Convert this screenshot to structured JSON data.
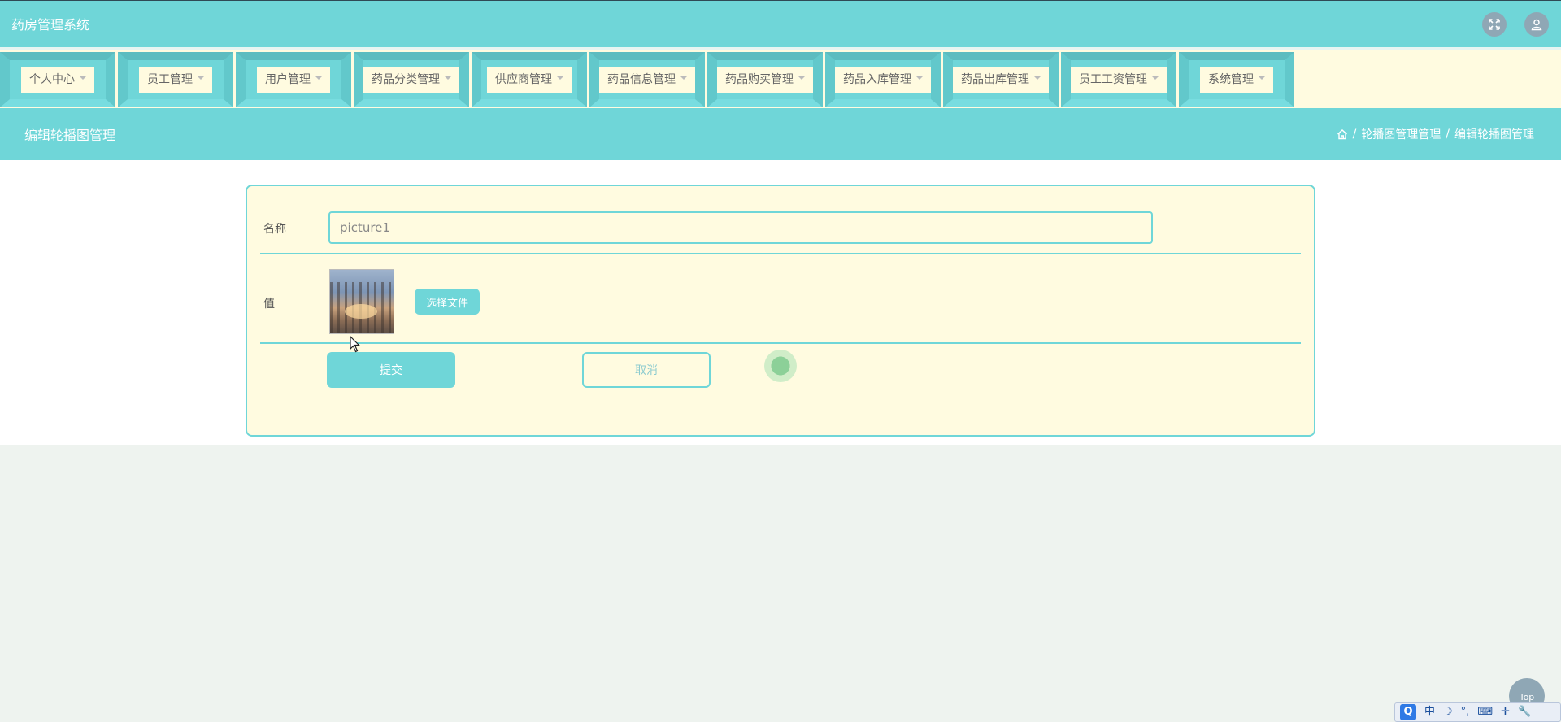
{
  "app": {
    "title": "药房管理系统"
  },
  "header_icons": {
    "fullscreen": "fullscreen-icon",
    "user": "user-icon"
  },
  "nav": {
    "items": [
      {
        "label": "个人中心"
      },
      {
        "label": "员工管理"
      },
      {
        "label": "用户管理"
      },
      {
        "label": "药品分类管理"
      },
      {
        "label": "供应商管理"
      },
      {
        "label": "药品信息管理"
      },
      {
        "label": "药品购买管理"
      },
      {
        "label": "药品入库管理"
      },
      {
        "label": "药品出库管理"
      },
      {
        "label": "员工工资管理"
      },
      {
        "label": "系统管理"
      }
    ]
  },
  "page": {
    "title": "编辑轮播图管理",
    "breadcrumb": {
      "sep1": "/",
      "level1": "轮播图管理管理",
      "sep2": "/",
      "level2": "编辑轮播图管理"
    }
  },
  "form": {
    "name_label": "名称",
    "name_value": "picture1",
    "value_label": "值",
    "file_button": "选择文件",
    "submit": "提交",
    "cancel": "取消"
  },
  "footer": {
    "top_button": "Top"
  },
  "ime": {
    "q": "Q",
    "lang": "中",
    "moon": "☽",
    "dots": "°,",
    "keyboard": "⌨",
    "punct": "✛",
    "tools": "🔧"
  },
  "colors": {
    "accent": "#6fd6d8",
    "panel": "#fffbe0",
    "background": "#eef3ef",
    "icon_circle": "#8fa7b5"
  }
}
